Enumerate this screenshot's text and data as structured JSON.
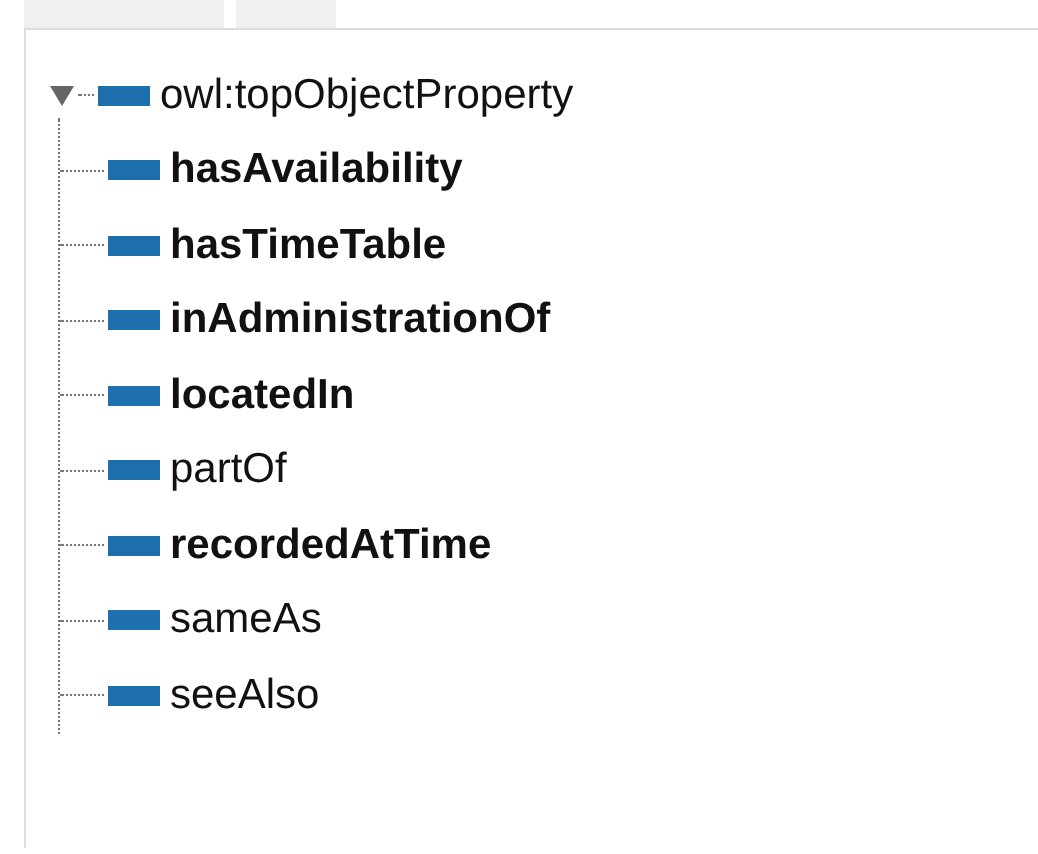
{
  "tree": [
    {
      "label": "owl:topObjectProperty",
      "bold": false,
      "expanded": true,
      "children": [
        {
          "label": "hasAvailability",
          "bold": true
        },
        {
          "label": "hasTimeTable",
          "bold": true
        },
        {
          "label": "inAdministrationOf",
          "bold": true
        },
        {
          "label": "locatedIn",
          "bold": true
        },
        {
          "label": "partOf",
          "bold": false
        },
        {
          "label": "recordedAtTime",
          "bold": true
        },
        {
          "label": "sameAs",
          "bold": false
        },
        {
          "label": "seeAlso",
          "bold": false
        }
      ]
    }
  ]
}
